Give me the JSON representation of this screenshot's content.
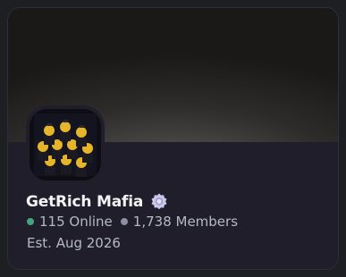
{
  "server": {
    "name": "GetRich Mafia",
    "badge_icon": "verified-partner-badge-icon",
    "online_text": "115 Online",
    "members_text": "1,738 Members",
    "established_text": "Est. Aug 2026"
  },
  "colors": {
    "online_dot": "#43a47d",
    "members_dot": "#8e8fa0",
    "badge": "#c9c7ea",
    "card_bg": "#1f1e2a"
  }
}
